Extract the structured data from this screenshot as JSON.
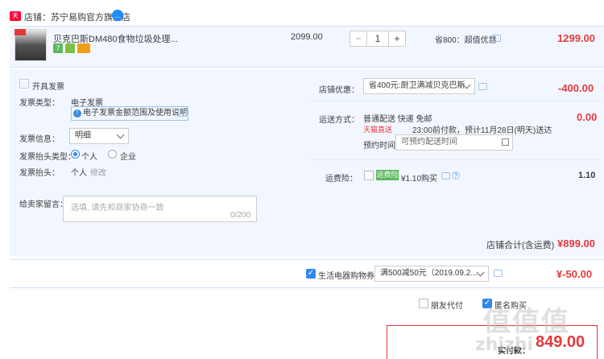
{
  "store": {
    "badge": "天猫",
    "name": "店铺：苏宁易购官方旗舰店",
    "chat_badge": "…"
  },
  "item": {
    "title": "贝克巴斯DM480食物垃圾处理...",
    "unit_price": "2099.00",
    "quantity": "1",
    "minus": "−",
    "plus": "+",
    "promo": "省800：超值优惠",
    "subtotal": "1299.00",
    "tag_seven": "7"
  },
  "invoice": {
    "open_label": "开具发票",
    "type_label": "发票类型：",
    "type_value": "电子发票",
    "info_text": "电子发票金额范围及使用说明",
    "info_label": "发票信息：",
    "info_select": "明细",
    "header_type_label": "发票抬头类型：",
    "option_personal": "个人",
    "option_company": "企业",
    "header_label": "发票抬头：",
    "header_value": "个人",
    "edit_link": "修改"
  },
  "message": {
    "label": "给卖家留言：",
    "placeholder": "选填, 请先和商家协商一致",
    "counter": "0/200"
  },
  "shop_discount": {
    "label": "店铺优惠：",
    "select": "省400元:厨卫满减贝克巴斯",
    "value": "-400.00"
  },
  "shipping": {
    "label": "运送方式：",
    "method": "普通配送 快递 免邮",
    "value": "0.00",
    "tmall_logo": "天猫直送",
    "promise": "23:00前付款，预计11月28日(明天)送达",
    "reserve_label": "预约时间",
    "reserve_placeholder": "可预约配送时间"
  },
  "insurance": {
    "label": "运费险：",
    "badge": "运费险",
    "price": "¥1.10购买",
    "value": "1.10"
  },
  "store_total": {
    "label": "店铺合计(含运费)",
    "value": "¥899.00"
  },
  "coupon": {
    "label": "生活电器购物券",
    "select": "满500减50元（2019.09.2...",
    "value": "¥-50.00"
  },
  "footer": {
    "friend_pay": "朋友代付",
    "anonymous": "匿名购买",
    "pay_label": "实付款：",
    "pay_value": "849.00"
  },
  "watermark": {
    "logo": "值",
    "text": "zhizhi"
  },
  "colors": {
    "accent_red": "#e4393c",
    "accent_blue": "#2f88f0",
    "panel_bg": "#f2f7ff"
  }
}
